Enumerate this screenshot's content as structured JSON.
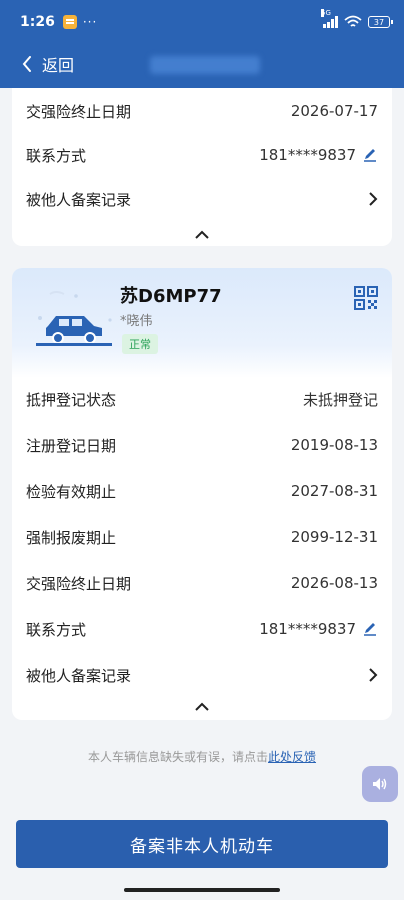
{
  "status_bar": {
    "time": "1:26",
    "dots": "···",
    "network": "5G",
    "battery": "37"
  },
  "nav": {
    "back_label": "返回"
  },
  "card1": {
    "rows": [
      {
        "label": "交强险终止日期",
        "value": "2026-07-17"
      },
      {
        "label": "联系方式",
        "value": "181****9837"
      },
      {
        "label": "被他人备案记录",
        "value": ""
      }
    ]
  },
  "card2": {
    "plate": "苏D6MP77",
    "owner": "*晓伟",
    "status": "正常",
    "rows": [
      {
        "label": "抵押登记状态",
        "value": "未抵押登记"
      },
      {
        "label": "注册登记日期",
        "value": "2019-08-13"
      },
      {
        "label": "检验有效期止",
        "value": "2027-08-31"
      },
      {
        "label": "强制报废期止",
        "value": "2099-12-31"
      },
      {
        "label": "交强险终止日期",
        "value": "2026-08-13"
      },
      {
        "label": "联系方式",
        "value": "181****9837"
      },
      {
        "label": "被他人备案记录",
        "value": ""
      }
    ]
  },
  "feedback": {
    "text": "本人车辆信息缺失或有误，请点击",
    "link": "此处反馈"
  },
  "primary_button": "备案非本人机动车",
  "colors": {
    "primary": "#2a63b4",
    "badge_bg": "#dcf3e2",
    "badge_text": "#2aa258"
  }
}
